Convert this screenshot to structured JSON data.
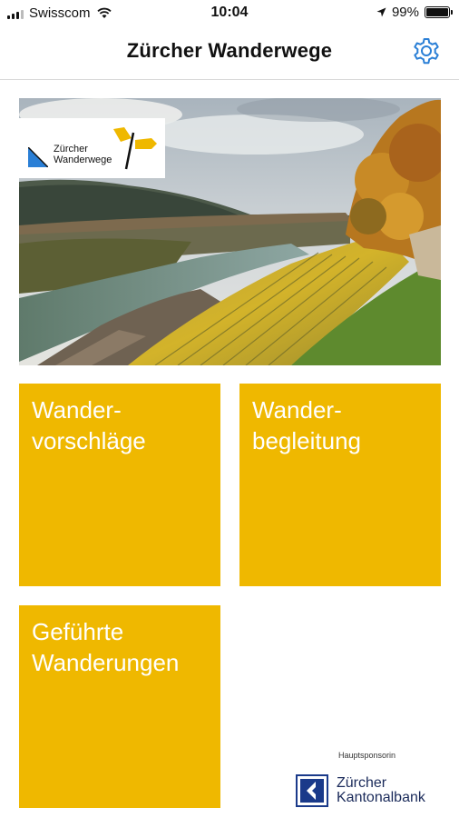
{
  "status_bar": {
    "carrier": "Swisscom",
    "time": "10:04",
    "battery": "99%",
    "battery_level": 0.99
  },
  "nav": {
    "title": "Zürcher Wanderwege"
  },
  "hero": {
    "logo_line1": "Zürcher",
    "logo_line2": "Wanderwege"
  },
  "tiles": [
    {
      "line1": "Wander-",
      "line2": "vorschläge"
    },
    {
      "line1": "Wander-",
      "line2": "begleitung"
    },
    {
      "line1": "Geführte",
      "line2": "Wanderungen"
    }
  ],
  "sponsor": {
    "label": "Hauptsponsorin",
    "name_line1": "Zürcher",
    "name_line2": "Kantonalbank"
  },
  "colors": {
    "tile": "#efb800",
    "accent": "#2a7fd6"
  }
}
